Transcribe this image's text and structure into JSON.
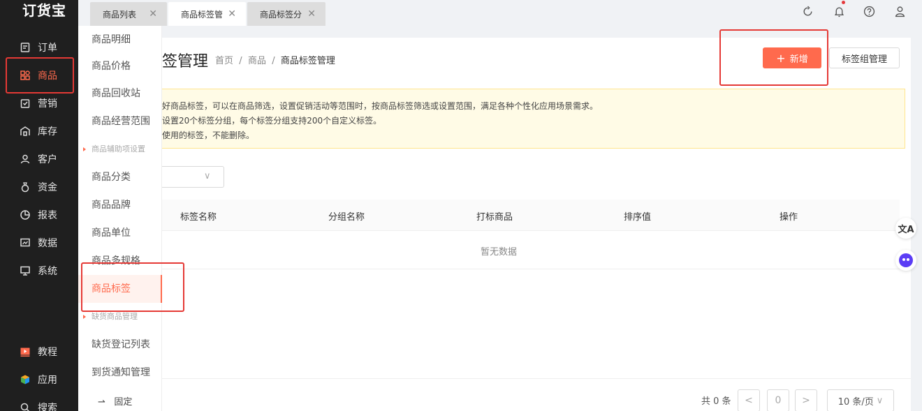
{
  "app": {
    "logo": "订货宝"
  },
  "nav": {
    "items": [
      {
        "label": "订单",
        "icon": "order-icon"
      },
      {
        "label": "商品",
        "icon": "grid-icon",
        "active": true
      },
      {
        "label": "营销",
        "icon": "marketing-icon"
      },
      {
        "label": "库存",
        "icon": "warehouse-icon"
      },
      {
        "label": "客户",
        "icon": "user-icon"
      },
      {
        "label": "资金",
        "icon": "money-bag-icon"
      },
      {
        "label": "报表",
        "icon": "pie-chart-icon"
      },
      {
        "label": "数据",
        "icon": "data-icon"
      },
      {
        "label": "系统",
        "icon": "monitor-icon"
      }
    ],
    "bottom": [
      {
        "label": "教程",
        "icon": "video-icon"
      },
      {
        "label": "应用",
        "icon": "cube-icon"
      },
      {
        "label": "搜索",
        "icon": "search-icon"
      }
    ]
  },
  "tabs": [
    {
      "label": "商品列表"
    },
    {
      "label": "商品标签管"
    },
    {
      "label": "商品标签分"
    }
  ],
  "submenu": {
    "items": [
      "商品明细",
      "商品价格",
      "商品回收站",
      "商品经营范围",
      "商品辅助项设置",
      "商品分类",
      "商品品牌",
      "商品单位",
      "商品多规格",
      "商品标签",
      "缺货商品管理",
      "缺货登记列表",
      "到货通知管理"
    ],
    "pin_label": "固定"
  },
  "page": {
    "title": "签管理",
    "breadcrumb": [
      "首页",
      "商品",
      "商品标签管理"
    ],
    "add_button": "新增",
    "group_button": "标签组管理",
    "notice": [
      "好商品标签，可以在商品筛选，设置促销活动等范围时，按商品标签筛选或设置范围，满足各种个性化应用场景需求。",
      "设置20个标签分组，每个标签分组支持200个自定义标签。",
      "使用的标签，不能删除。"
    ],
    "table": {
      "columns": [
        "标签名称",
        "分组名称",
        "打标商品",
        "排序值",
        "操作"
      ],
      "empty": "暂无数据"
    },
    "pagination": {
      "total": "共 0 条",
      "current": "0",
      "page_size": "10 条/页"
    }
  },
  "floats": [
    "文A"
  ],
  "colors": {
    "accent": "#ff6a4d",
    "annotation": "#e53935"
  }
}
